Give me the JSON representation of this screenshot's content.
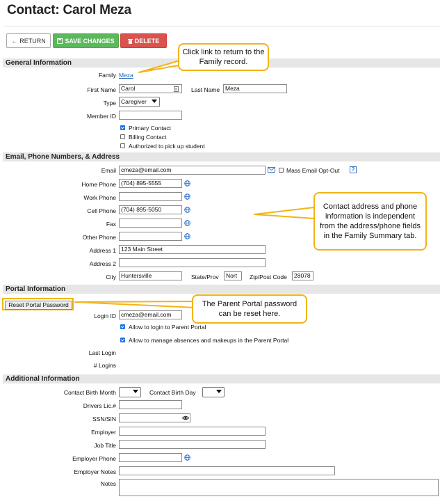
{
  "page": {
    "title": "Contact: Carol Meza"
  },
  "toolbar": {
    "return_label": "RETURN",
    "save_label": "SAVE CHANGES",
    "delete_label": "DELETE"
  },
  "sections": {
    "general": "General Information",
    "contact": "Email, Phone Numbers, & Address",
    "portal": "Portal Information",
    "additional": "Additional Information"
  },
  "general": {
    "family_label": "Family",
    "family_value": "Meza",
    "first_name_label": "First Name",
    "first_name_value": "Carol",
    "last_name_label": "Last Name",
    "last_name_value": "Meza",
    "type_label": "Type",
    "type_value": "Caregiver",
    "member_id_label": "Member ID",
    "member_id_value": "",
    "checkboxes": [
      {
        "label": "Primary Contact",
        "checked": true
      },
      {
        "label": "Billing Contact",
        "checked": false
      },
      {
        "label": "Authorized to pick up student",
        "checked": false
      }
    ]
  },
  "contact": {
    "email_label": "Email",
    "email_value": "cmeza@email.com",
    "mass_email_label": "Mass Email Opt-Out",
    "mass_email_checked": false,
    "help_icon": "?",
    "home_phone_label": "Home Phone",
    "home_phone_value": "(704) 895-5555",
    "work_phone_label": "Work Phone",
    "work_phone_value": "",
    "cell_phone_label": "Cell Phone",
    "cell_phone_value": "(704) 895-5050",
    "fax_label": "Fax",
    "fax_value": "",
    "other_phone_label": "Other Phone",
    "other_phone_value": "",
    "address1_label": "Address 1",
    "address1_value": "123 Main Street",
    "address2_label": "Address 2",
    "address2_value": "",
    "city_label": "City",
    "city_value": "Huntersville",
    "state_label": "State/Prov",
    "state_value": "Nort",
    "zip_label": "Zip/Post Code",
    "zip_value": "28078"
  },
  "portal": {
    "reset_label": "Reset Portal Password",
    "login_id_label": "Login ID",
    "login_id_value": "cmeza@email.com",
    "allow_login_label": "Allow to login to Parent Portal",
    "allow_login_checked": true,
    "allow_manage_label": "Allow to manage absences and makeups in the Parent Portal",
    "allow_manage_checked": true,
    "last_login_label": "Last Login",
    "logins_label": "# Logins"
  },
  "additional": {
    "birth_month_label": "Contact Birth Month",
    "birth_day_label": "Contact Birth Day",
    "drivers_label": "Drivers Lic.#",
    "ssn_label": "SSN/SIN",
    "employer_label": "Employer",
    "job_title_label": "Job Title",
    "employer_phone_label": "Employer Phone",
    "employer_notes_label": "Employer Notes",
    "notes_label": "Notes"
  },
  "callouts": {
    "family": "Click link to return to the Family record.",
    "address": "Contact address and phone information is independent from the address/phone fields in the Family Summary tab.",
    "portal": "The Parent Portal password can be reset here."
  },
  "colors": {
    "callout_border": "#f2b318",
    "save_green": "#5cb85c",
    "delete_red": "#d9534f",
    "globe_blue": "#3a78c9"
  },
  "icons": [
    "arrow-left-icon",
    "save-icon",
    "trash-icon",
    "contact-card-icon",
    "envelope-icon",
    "help-icon",
    "globe-icon",
    "eye-icon",
    "chevron-down-icon"
  ]
}
